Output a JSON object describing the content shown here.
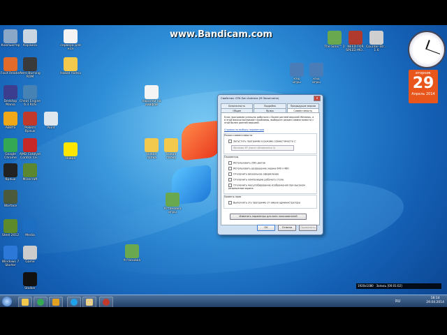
{
  "watermark": "www.Bandicam.com",
  "desktop_icons": [
    {
      "label": "Компьютер",
      "color": "#8aa7c8"
    },
    {
      "label": "Корзина",
      "color": "#c9d6e2"
    },
    {
      "label": "сервера для\nкса",
      "color": "#f4f4f4"
    },
    {
      "label": "Foxit Reader",
      "color": "#e06b2a"
    },
    {
      "label": "Nero Burning\nROM",
      "color": "#3a3a3a"
    },
    {
      "label": "Новая папка",
      "color": "#f2c94c"
    },
    {
      "label": "Desktop\nMania",
      "color": "#3d3d8f"
    },
    {
      "label": "Cheat Engine\n6.3 RUS",
      "color": "#4682b4"
    },
    {
      "label": "ABBYS",
      "color": "#f0a818"
    },
    {
      "label": "Pokerri\nЯрлык",
      "color": "#c0392b"
    },
    {
      "label": "Paint",
      "color": "#dfe7ee"
    },
    {
      "label": "Google\nChrome",
      "color": "#34a853"
    },
    {
      "label": "AMD Catalyst\nControl Ce...",
      "color": "#c62828"
    },
    {
      "label": "Новая",
      "color": "#ffe600"
    },
    {
      "label": "Ярлык",
      "color": "#222222"
    },
    {
      "label": "Minecraft",
      "color": "#5b8731"
    },
    {
      "label": "Warface",
      "color": "#4a5a3a"
    },
    {
      "label": "Steel 2012",
      "color": "#5d8a2a"
    },
    {
      "label": "Media",
      "color": "#1b6ec2"
    },
    {
      "label": "Windows 7\nStarter",
      "color": "#2b78d8"
    },
    {
      "label": "Game",
      "color": "#cccccc"
    },
    {
      "label": "Stalker",
      "color": "#111111"
    },
    {
      "label": "The Sims™ 2",
      "color": "#6aa84f"
    },
    {
      "label": "NEED FOR\nSPEED MO...",
      "color": "#b03a2e"
    },
    {
      "label": "Counter-Str...\n1.6",
      "color": "#cfcfcf"
    },
    {
      "label": "кэш\nигры",
      "color": "#4a7db8"
    },
    {
      "label": "кэш\nигры",
      "color": "#4a7db8"
    },
    {
      "label": "паролей на\nвайфай",
      "color": "#f4f4f4"
    },
    {
      "label": "Новая\nпапка",
      "color": "#f2c94c"
    },
    {
      "label": "Новая\nпапка",
      "color": "#f2c94c"
    },
    {
      "label": "Установка\nигры",
      "color": "#6aa84f"
    },
    {
      "label": "Установка",
      "color": "#6aa84f"
    }
  ],
  "calendar": {
    "weekday": "вторник",
    "day": "29",
    "month_year": "Апрель 2014"
  },
  "dialog": {
    "title": "Свойства: GTA San Andreas (M Закончено)",
    "tabs_top": [
      "Безопасность",
      "Подробно",
      "Предыдущие версии"
    ],
    "tabs_bottom": [
      "Общие",
      "Ярлык",
      "Совместимость"
    ],
    "active_tab": "Совместимость",
    "intro": "Если программа успешно работала с более ранней версией Windows, а в этой версии возникают проблемы, выберите режим совместимости с этой более ранней версией.",
    "help_link": "Справка по выбору параметров",
    "compat_group": "Режим совместимости",
    "compat_checkbox": "Запустить программу в режиме совместимости с:",
    "compat_select": "Windows XP (пакет обновления 3)",
    "params_group": "Параметры",
    "params": [
      "Использовать 256 цветов",
      "Использовать разрешение экрана 640 x 480",
      "Отключить визуальное оформление",
      "Отключить композицию рабочего стола",
      "Отключить масштабирование изображения при высоком разрешении экрана"
    ],
    "privilege_group": "Уровень прав",
    "privilege_checkbox": "Выполнять эту программу от имени администратора",
    "change_all_button": "Изменить параметры для всех пользователей",
    "ok_button": "OK",
    "cancel_button": "Отмена",
    "apply_button": "Применить"
  },
  "recording": {
    "resolution": "1920x1080",
    "status": "Запись [00:01:02]"
  },
  "tray": {
    "lang": "RU",
    "time": "18:14",
    "date": "29.04.2014"
  }
}
